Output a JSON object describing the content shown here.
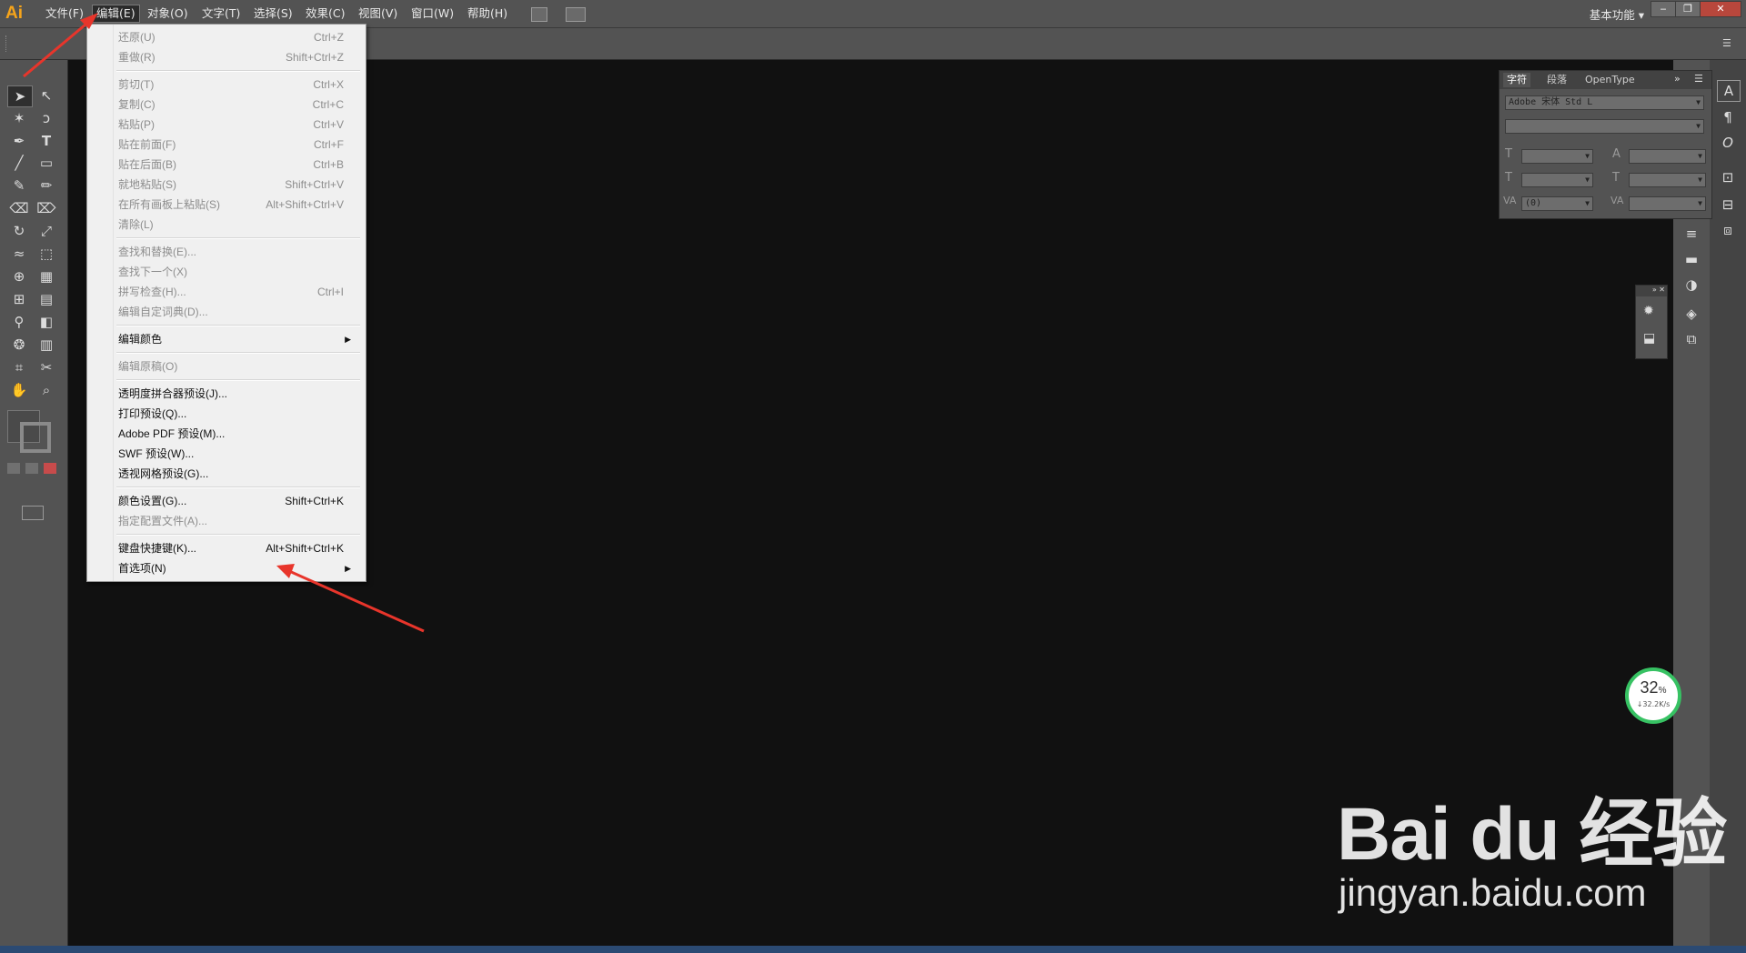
{
  "app": {
    "logo": "Ai"
  },
  "menubar": {
    "items": [
      "文件(F)",
      "编辑(E)",
      "对象(O)",
      "文字(T)",
      "选择(S)",
      "效果(C)",
      "视图(V)",
      "窗口(W)",
      "帮助(H)"
    ],
    "workspace": "基本功能"
  },
  "edit_menu": {
    "items": [
      {
        "label": "还原(U)",
        "shortcut": "Ctrl+Z",
        "enabled": false
      },
      {
        "label": "重做(R)",
        "shortcut": "Shift+Ctrl+Z",
        "enabled": false
      },
      {
        "label": "剪切(T)",
        "shortcut": "Ctrl+X",
        "enabled": false
      },
      {
        "label": "复制(C)",
        "shortcut": "Ctrl+C",
        "enabled": false
      },
      {
        "label": "粘贴(P)",
        "shortcut": "Ctrl+V",
        "enabled": false
      },
      {
        "label": "贴在前面(F)",
        "shortcut": "Ctrl+F",
        "enabled": false
      },
      {
        "label": "贴在后面(B)",
        "shortcut": "Ctrl+B",
        "enabled": false
      },
      {
        "label": "就地粘贴(S)",
        "shortcut": "Shift+Ctrl+V",
        "enabled": false
      },
      {
        "label": "在所有画板上粘贴(S)",
        "shortcut": "Alt+Shift+Ctrl+V",
        "enabled": false
      },
      {
        "label": "清除(L)",
        "shortcut": "",
        "enabled": false
      },
      {
        "label": "查找和替换(E)...",
        "shortcut": "",
        "enabled": false
      },
      {
        "label": "查找下一个(X)",
        "shortcut": "",
        "enabled": false
      },
      {
        "label": "拼写检查(H)...",
        "shortcut": "Ctrl+I",
        "enabled": false
      },
      {
        "label": "编辑自定词典(D)...",
        "shortcut": "",
        "enabled": false
      },
      {
        "label": "编辑颜色",
        "shortcut": "",
        "enabled": true,
        "submenu": true
      },
      {
        "label": "编辑原稿(O)",
        "shortcut": "",
        "enabled": false
      },
      {
        "label": "透明度拼合器预设(J)...",
        "shortcut": "",
        "enabled": true
      },
      {
        "label": "打印预设(Q)...",
        "shortcut": "",
        "enabled": true
      },
      {
        "label": "Adobe PDF 预设(M)...",
        "shortcut": "",
        "enabled": true
      },
      {
        "label": "SWF 预设(W)...",
        "shortcut": "",
        "enabled": true
      },
      {
        "label": "透视网格预设(G)...",
        "shortcut": "",
        "enabled": true
      },
      {
        "label": "颜色设置(G)...",
        "shortcut": "Shift+Ctrl+K",
        "enabled": true
      },
      {
        "label": "指定配置文件(A)...",
        "shortcut": "",
        "enabled": false
      },
      {
        "label": "键盘快捷键(K)...",
        "shortcut": "Alt+Shift+Ctrl+K",
        "enabled": true
      },
      {
        "label": "首选项(N)",
        "shortcut": "",
        "enabled": true,
        "submenu": true
      }
    ]
  },
  "character_panel": {
    "tabs": [
      "字符",
      "段落",
      "OpenType"
    ],
    "font_family": "Adobe 宋体 Std L",
    "font_style": "",
    "tracking": "(0)"
  },
  "progress": {
    "percent": "32",
    "percent_sign": "%",
    "speed": "↓32.2K/s"
  },
  "watermark": {
    "brand": "Bai du 经验",
    "url": "jingyan.baidu.com"
  },
  "colors": {
    "accent": "#f6a41a",
    "progress_ring": "#37c263",
    "annotation_arrow": "#e8352b"
  }
}
